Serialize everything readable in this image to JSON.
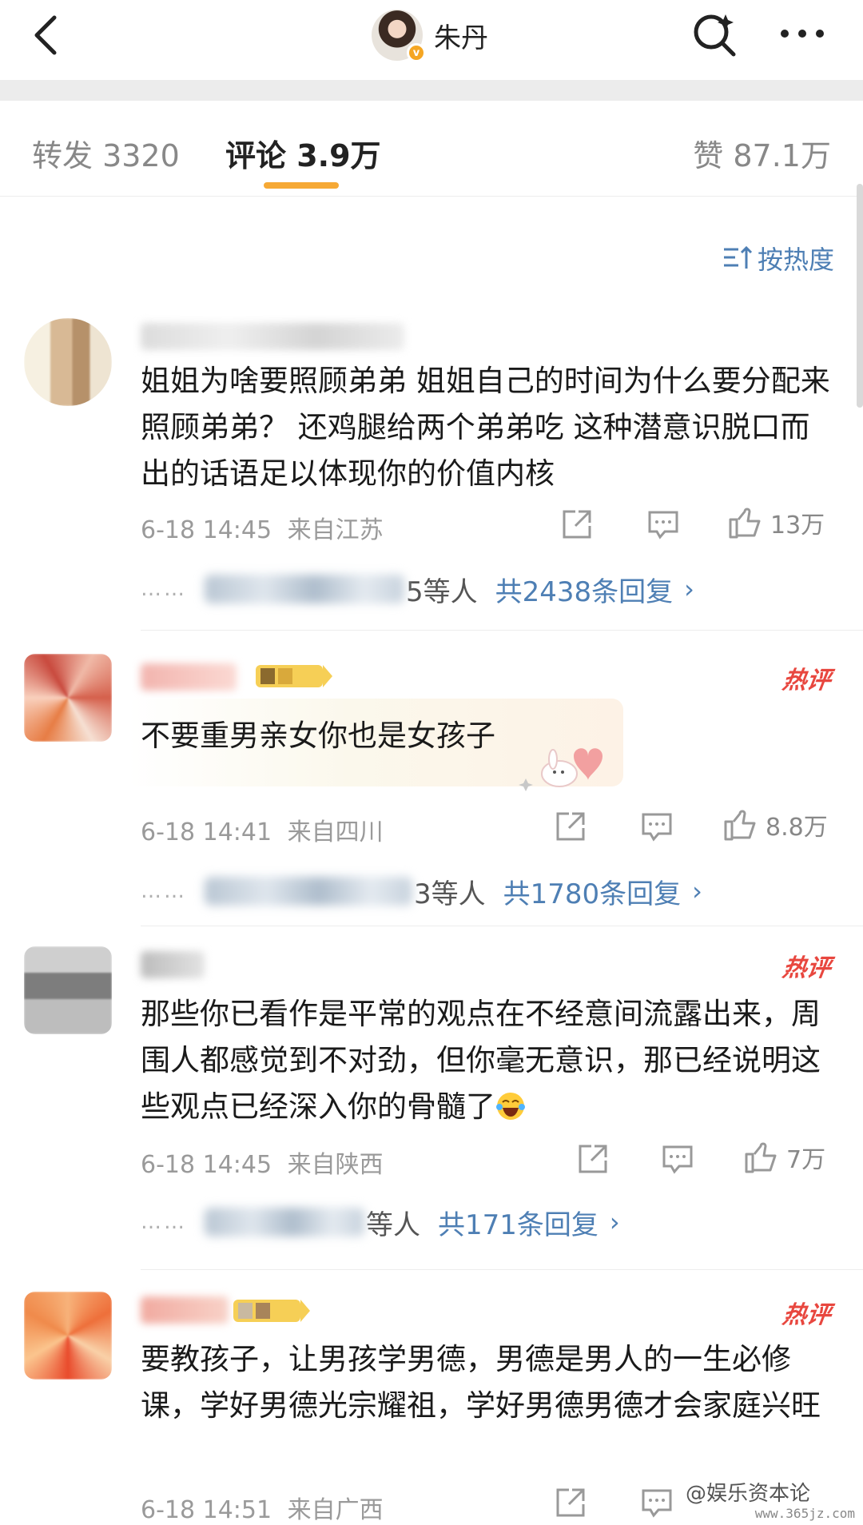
{
  "header": {
    "title": "朱丹",
    "verified_badge": "v"
  },
  "tabs": {
    "forward": "转发 3320",
    "comment": "评论 3.9万",
    "like": "赞 87.1万"
  },
  "sort": {
    "label": "按热度"
  },
  "comments": [
    {
      "hot_label": "",
      "body": "姐姐为啥要照顾弟弟 姐姐自己的时间为什么要分配来照顾弟弟？  还鸡腿给两个弟弟吃 这种潜意识脱口而出的话语足以体现你的价值内核",
      "time": "6-18 14:45",
      "location": "来自江苏",
      "likes": "13万",
      "reply_prefix": "",
      "reply_suffix": "5等人",
      "reply_total": "共2438条回复"
    },
    {
      "hot_label": "热评",
      "body": "不要重男亲女你也是女孩子",
      "time": "6-18 14:41",
      "location": "来自四川",
      "likes": "8.8万",
      "reply_prefix": "",
      "reply_suffix": "3等人",
      "reply_total": "共1780条回复"
    },
    {
      "hot_label": "热评",
      "body": "那些你已看作是平常的观点在不经意间流露出来，周围人都感觉到不对劲，但你毫无意识，那已经说明这些观点已经深入你的骨髓了",
      "time": "6-18 14:45",
      "location": "来自陕西",
      "likes": "7万",
      "reply_prefix": "",
      "reply_suffix": "等人",
      "reply_total": "共171条回复"
    },
    {
      "hot_label": "热评",
      "body": "要教孩子，让男孩学男德，男德是男人的一生必修课，学好男德光宗耀祖，学好男德男德才会家庭兴旺",
      "time": "6-18 14:51",
      "location": "来自广西",
      "likes": "",
      "reply_prefix": "",
      "reply_suffix": "",
      "reply_total": ""
    }
  ],
  "reply_arrow": "›",
  "reply_dots": "……",
  "watermark": {
    "text": "@娱乐资本论",
    "url": "www.365jz.com"
  },
  "colors": {
    "accent": "#f6a935",
    "link": "#4e7fb4",
    "hot": "#e8473f"
  }
}
